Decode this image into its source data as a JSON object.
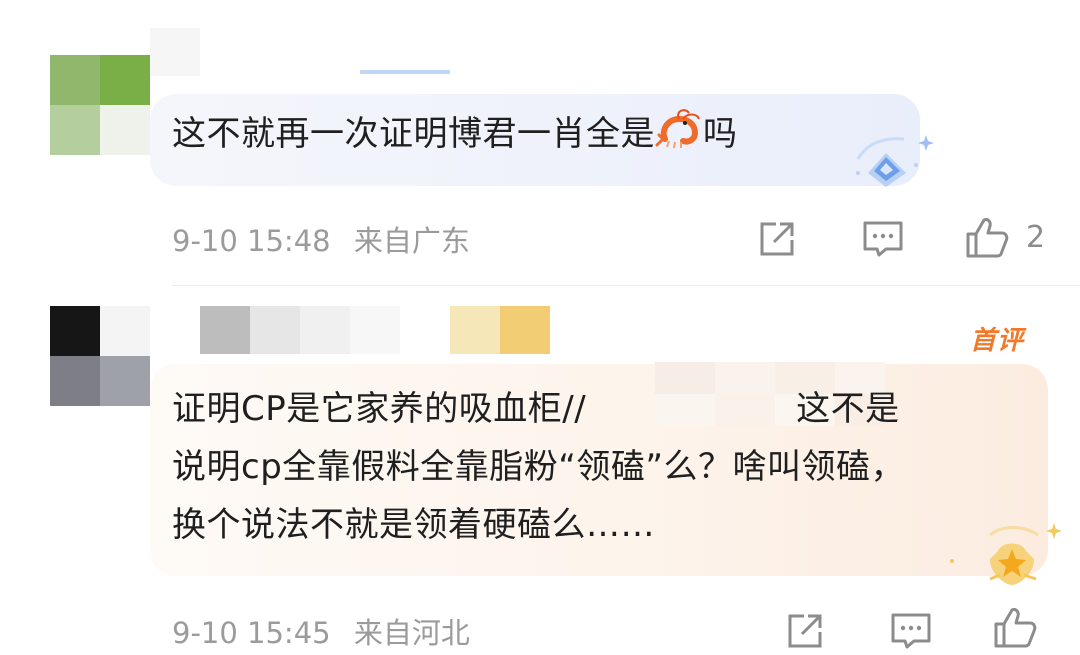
{
  "comments": [
    {
      "text_before_emoji": "这不就再一次证明博君一肖全是",
      "emoji": "shrimp-emoji",
      "text_after_emoji": "吗",
      "time": "9-10 15:48",
      "location": "来自广东",
      "like_count": "2",
      "bubble_color": "#eef1fb",
      "badge_icon": "blue-diamond-badge-icon"
    },
    {
      "tag": "首评",
      "text_line1_before": "证明CP是它家养的吸血柜//",
      "text_line1_after": "这不是",
      "text_line2": "说明cp全靠假料全靠脂粉“领磕”么？啥叫领磕，",
      "text_line3": "换个说法不就是领着硬磕么……",
      "time": "9-10 15:45",
      "location": "来自河北",
      "bubble_color": "#fdf2e8",
      "badge_icon": "gold-star-badge-icon"
    }
  ],
  "icons": {
    "share": "share-icon",
    "reply": "comment-icon",
    "like": "thumbs-up-icon"
  },
  "colors": {
    "text": "#1f1f1f",
    "meta": "#9b9b9b",
    "tag": "#f07a2a"
  }
}
